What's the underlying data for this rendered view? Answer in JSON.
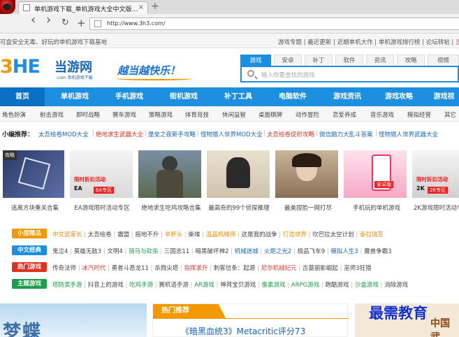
{
  "browser": {
    "tab_title": "单机游戏下载_单机游戏大全中文版…",
    "tab_close": "×",
    "new_tab": "+",
    "back": "‹",
    "forward": "›",
    "reload": "↻",
    "add": "+",
    "url": "http://www.3h3.com/"
  },
  "topstrip": {
    "left_text": "可盘安全无毒、好玩的单机游戏下载基地",
    "links": [
      "游戏专题",
      "最近更新",
      "近期单机大作",
      "单机游戏排行榜",
      "论坛转帖"
    ],
    "hot": "当"
  },
  "header": {
    "brand_a": "3",
    "brand_b": "H",
    "brand_c": "E",
    "brand_cn": "当游网",
    "brand_sub": ".com 单机游戏下载",
    "slogan": "越当越快乐！",
    "search_tabs": [
      "游戏",
      "安卓",
      "补丁",
      "软件",
      "资讯",
      "攻略",
      "视频"
    ],
    "search_placeholder": "输入你要查找的游戏"
  },
  "mainnav": [
    "首页",
    "单机游戏",
    "手机游戏",
    "街机游戏",
    "补丁工具",
    "电脑软件",
    "游戏资讯",
    "游戏攻略",
    "游戏视"
  ],
  "categories": [
    "角色扮演",
    "射击游戏",
    "即时战略",
    "赛车游戏",
    "策略游戏",
    "体育竞技",
    "休闲益智",
    "桌面棋牌",
    "动作冒险",
    "恋爱养成",
    "音乐游戏",
    "模拟经营",
    "其它"
  ],
  "recommend": {
    "label": "小编推荐：",
    "items": [
      {
        "text": "太吾绘卷MOD大全",
        "color": "blue"
      },
      {
        "text": "绝地求生武器大全",
        "color": "red"
      },
      {
        "text": "堡垒之夜新手攻略",
        "color": "blue"
      },
      {
        "text": "怪物猎人世界MOD大全",
        "color": "blue"
      },
      {
        "text": "太吾绘卷促织攻略",
        "color": "red"
      },
      {
        "text": "微信脑力大乱斗答案",
        "color": "blue"
      },
      {
        "text": "怪物猎人世界武器大全",
        "color": "blue"
      }
    ]
  },
  "thumbs": [
    {
      "caption": "逃离方块重关合集",
      "badge": "攻略",
      "promo": "",
      "logo": "",
      "tag": ""
    },
    {
      "caption": "EA游戏限时活动专区",
      "badge": "",
      "promo": "限时折扣活动",
      "logo": "EA",
      "tag": "EA专区"
    },
    {
      "caption": "绝地求生吃鸡攻略合集",
      "badge": "",
      "promo": "",
      "logo": "",
      "tag": ""
    },
    {
      "caption": "最高奇的99个侦探推理",
      "badge": "",
      "promo": "",
      "logo": "",
      "tag": ""
    },
    {
      "caption": "最美捏脸一网打尽",
      "badge": "",
      "promo": "",
      "logo": "",
      "tag": ""
    },
    {
      "caption": "手机玩的单机游戏",
      "badge": "",
      "promo": "",
      "logo": "",
      "tag": "安卓版"
    },
    {
      "caption": "2K游戏限时活动专区",
      "badge": "",
      "promo": "限时折扣活动",
      "logo": "2K",
      "tag": "2K专区"
    }
  ],
  "rows": [
    {
      "label": "小型精品",
      "color": "#f39800",
      "links": [
        [
          "中文武家长",
          "o"
        ],
        [
          "太吾绘卷",
          "d"
        ],
        [
          "霜盟",
          "d"
        ],
        [
          "摇地不升",
          "d"
        ],
        [
          "辛杯头",
          "o"
        ],
        [
          "柴堆",
          "d"
        ],
        [
          "温品机械师",
          "o"
        ],
        [
          "这是我的战争",
          "d"
        ],
        [
          "打造世界",
          "o"
        ],
        [
          "坎巴拉太空计划",
          "d"
        ],
        [
          "泰拉瑞亚",
          "o"
        ]
      ]
    },
    {
      "label": "中文经典",
      "color": "#1d8fe0",
      "links": [
        [
          "鬼泣4",
          "d"
        ],
        [
          "英雄无敌3",
          "d"
        ],
        [
          "文明4",
          "d"
        ],
        [
          "骑马与砍杀",
          "g"
        ],
        [
          "三国志11",
          "d"
        ],
        [
          "暗黑破坏神2",
          "d"
        ],
        [
          "机械迷城",
          "b"
        ],
        [
          "火炬之光2",
          "b"
        ],
        [
          "极品飞车9",
          "d"
        ],
        [
          "模拟人生3",
          "b"
        ],
        [
          "魔兽争霸3",
          "d"
        ]
      ]
    },
    {
      "label": "热门游戏",
      "color": "#e0301e",
      "links": [
        [
          "传奇法师",
          "d"
        ],
        [
          "冰汽时代",
          "r"
        ],
        [
          "勇者斗恶龙11",
          "d"
        ],
        [
          "杀戮尖塔",
          "d"
        ],
        [
          "指挥求升",
          "r"
        ],
        [
          "刺客信条：起源",
          "d"
        ],
        [
          "尼尔机械纪元",
          "r"
        ],
        [
          "古墓丽影崛起",
          "d"
        ],
        [
          "巫师3狂猎",
          "d"
        ]
      ]
    },
    {
      "label": "主题游戏",
      "color": "#1b9e4a",
      "links": [
        [
          "塔防类手游",
          "g"
        ],
        [
          "抖音上的游戏",
          "d"
        ],
        [
          "吃鸡手游",
          "g"
        ],
        [
          "赛机语手游",
          "d"
        ],
        [
          "AR游戏",
          "g"
        ],
        [
          "神荷宝贝游戏",
          "d"
        ],
        [
          "像素游戏",
          "g"
        ],
        [
          "ARPG游戏",
          "g"
        ],
        [
          "跑酷游戏",
          "d"
        ],
        [
          "沙盒游戏",
          "g"
        ],
        [
          "消除游戏",
          "d"
        ]
      ]
    }
  ],
  "bottom": {
    "left_art": "梦蝶",
    "hot_tab": "热门推荐",
    "hot_title": "《暗黑血统3》Metacritic评分73",
    "right_art": "中国武",
    "watermark": "最需教育"
  }
}
